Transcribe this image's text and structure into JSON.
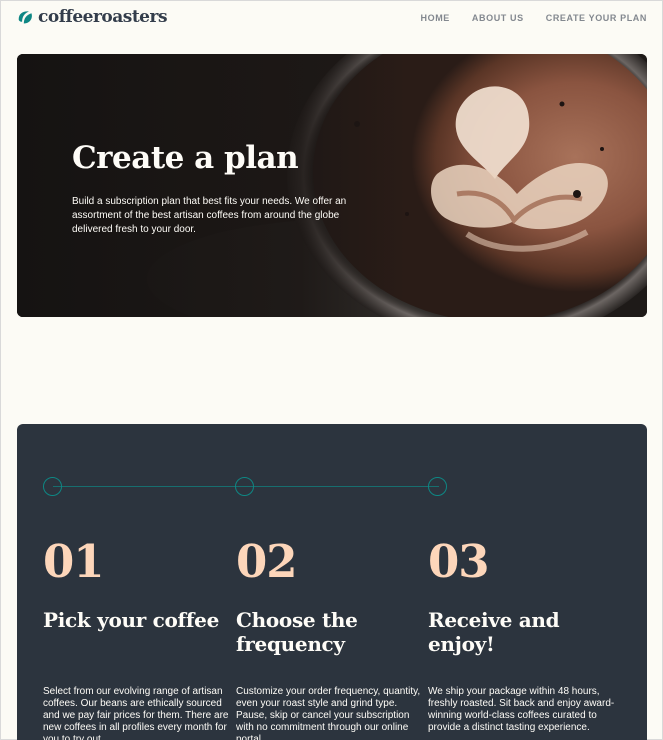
{
  "brand": {
    "name": "coffeeroasters",
    "icon": "coffee-bean-icon",
    "accent": "#0e8784"
  },
  "nav": {
    "home": "HOME",
    "about": "ABOUT US",
    "create": "CREATE YOUR PLAN"
  },
  "hero": {
    "title": "Create a plan",
    "subtitle": "Build a subscription plan that best fits your needs. We offer an assortment of the best artisan coffees from around the globe delivered fresh to your door."
  },
  "steps": [
    {
      "number": "01",
      "title": "Pick your coffee",
      "text": "Select from our evolving range of artisan coffees. Our beans are ethically sourced and we pay fair prices for them. There are new coffees in all profiles every month for you to try out."
    },
    {
      "number": "02",
      "title": "Choose the frequency",
      "text": "Customize your order frequency, quantity, even your roast style and grind type. Pause, skip or cancel your subscription with no commitment through our online portal."
    },
    {
      "number": "03",
      "title": "Receive and enjoy!",
      "text": "We ship your package within 48 hours, freshly roasted. Sit back and enjoy award-winning world-class coffees curated to provide a distinct tasting experience."
    }
  ],
  "colors": {
    "background": "#fcfbf5",
    "dark": "#2c343e",
    "peach": "#fdd6ba",
    "cream": "#fefcf7"
  }
}
